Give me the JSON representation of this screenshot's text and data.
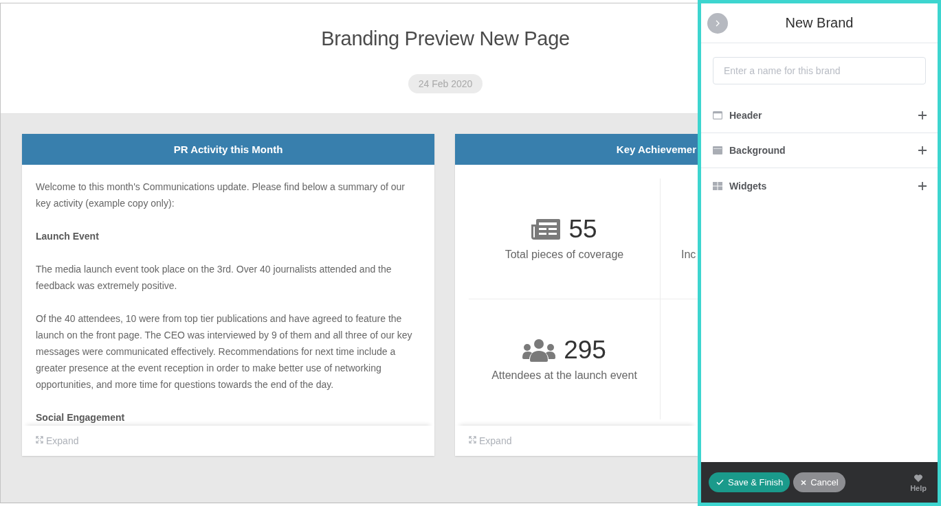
{
  "page": {
    "title": "Branding Preview New Page",
    "date": "24 Feb 2020"
  },
  "cards": [
    {
      "kind": "text",
      "title": "PR Activity this Month",
      "blocks": [
        {
          "kind": "paragraph",
          "text": "Welcome to this month's Communications update. Please find below a summary of our key activity (example copy only):"
        },
        {
          "kind": "heading",
          "text": "Launch Event"
        },
        {
          "kind": "paragraph",
          "text": "The media launch event took place on the 3rd. Over 40 journalists attended and the feedback was extremely positive."
        },
        {
          "kind": "paragraph",
          "text": "Of the 40 attendees, 10 were from top tier publications and have agreed to feature the launch on the front page. The CEO was interviewed by 9 of them and all three of our key messages were communicated effectively. Recommendations for next time include a greater presence at the event reception in order to make better use of networking opportunities, and more time for questions towards the end of the day."
        },
        {
          "kind": "heading",
          "text": "Social Engagement"
        }
      ],
      "expand_label": "Expand"
    },
    {
      "kind": "stats",
      "title": "Key Achievemer",
      "stats": [
        {
          "value": "55",
          "label": "Total pieces of coverage"
        },
        {
          "label": "Inc"
        },
        {
          "value": "295",
          "label": "Attendees at the launch event"
        }
      ],
      "expand_label": "Expand"
    }
  ],
  "panel": {
    "title": "New Brand",
    "name_field": {
      "placeholder": "Enter a name for this brand"
    },
    "sections": [
      {
        "label": "Header",
        "expanded": false
      },
      {
        "label": "Background",
        "expanded": false
      },
      {
        "label": "Widgets",
        "expanded": false
      }
    ],
    "buttons": [
      {
        "kind": "primary",
        "label": "Save & Finish"
      },
      {
        "kind": "secondary",
        "label": "Cancel"
      }
    ],
    "help": {
      "label": "Help"
    }
  }
}
